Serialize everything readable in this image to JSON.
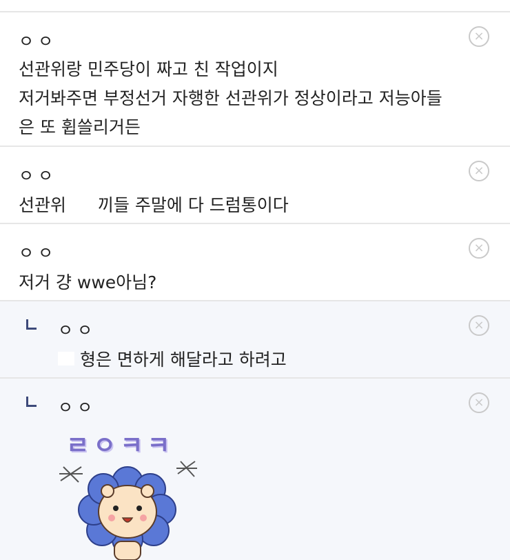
{
  "comments": [
    {
      "nick": "ㅇㅇ",
      "lines": [
        "선관위랑 민주당이 짜고 친 작업이지",
        "저거봐주면 부정선거 자행한 선관위가 정상이라고 저능아들",
        "은 또 휩쓸리거든"
      ],
      "delete_icon": "×"
    },
    {
      "nick": "ㅇㅇ",
      "text_before": "선관위",
      "text_after": "끼들 주말에 다 드럼통이다",
      "delete_icon": "×"
    },
    {
      "nick": "ㅇㅇ",
      "text": "저거 걍 wwe아님?",
      "delete_icon": "×"
    }
  ],
  "replies": [
    {
      "nick": "ㅇㅇ",
      "text": "형은 면하게 해달라고 하려고",
      "delete_icon": "×"
    },
    {
      "nick": "ㅇㅇ",
      "sticker_text": "ㄹㅇㅋㅋ",
      "sticker_icon": "lion-flower-sticker",
      "delete_icon": "×"
    }
  ],
  "colors": {
    "divider": "#e6e6e6",
    "reply_bg": "#f5f7fb",
    "reply_mark": "#3d4a7a",
    "sticker_text": "#7a6fc9",
    "sticker_petal": "#5a78d6",
    "sticker_face": "#fbe3c4"
  }
}
